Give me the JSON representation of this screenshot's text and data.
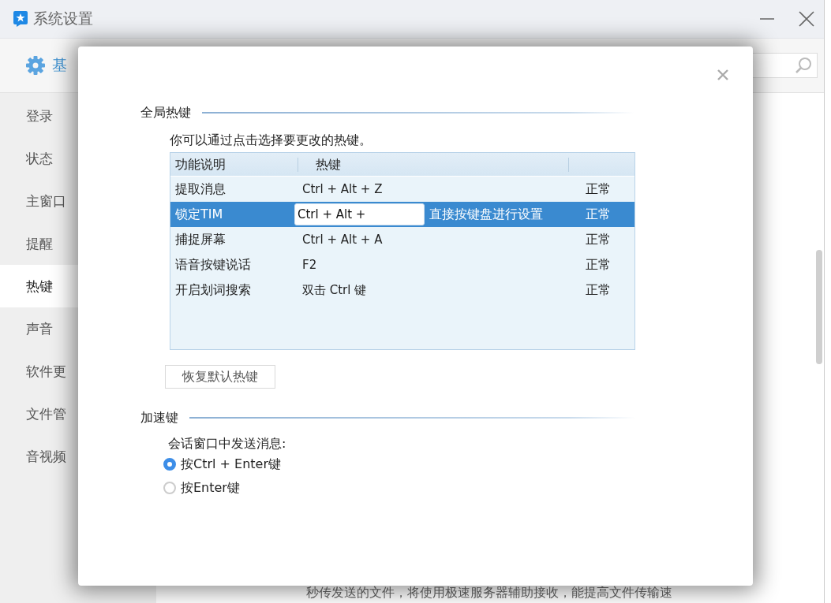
{
  "window": {
    "title": "系统设置"
  },
  "sidebar": {
    "header": "基",
    "items": [
      {
        "label": "登录",
        "selected": false
      },
      {
        "label": "状态",
        "selected": false
      },
      {
        "label": "主窗口",
        "selected": false
      },
      {
        "label": "提醒",
        "selected": false
      },
      {
        "label": "热键",
        "selected": true
      },
      {
        "label": "声音",
        "selected": false
      },
      {
        "label": "软件更",
        "selected": false
      },
      {
        "label": "文件管",
        "selected": false
      },
      {
        "label": "音视频",
        "selected": false
      }
    ]
  },
  "background_text": "秒传发送的文件，将使用极速服务器辅助接收，能提高文件传输速",
  "dialog": {
    "global_hotkeys": {
      "title": "全局热键",
      "description": "你可以通过点击选择要更改的热键。",
      "columns": [
        "功能说明",
        "热键"
      ],
      "rows": [
        {
          "name": "提取消息",
          "hotkey": "Ctrl + Alt + Z",
          "status": "正常",
          "selected": false
        },
        {
          "name": "锁定TIM",
          "hotkey": "Ctrl + Alt +",
          "hint": "直接按键盘进行设置",
          "status": "正常",
          "selected": true
        },
        {
          "name": "捕捉屏幕",
          "hotkey": "Ctrl + Alt + A",
          "status": "正常",
          "selected": false
        },
        {
          "name": "语音按键说话",
          "hotkey": "F2",
          "status": "正常",
          "selected": false
        },
        {
          "name": "开启划词搜索",
          "hotkey": "双击 Ctrl 键",
          "status": "正常",
          "selected": false
        }
      ],
      "restore_button": "恢复默认热键"
    },
    "accelerators": {
      "title": "加速键",
      "label": "会话窗口中发送消息:",
      "options": [
        {
          "label": "按Ctrl + Enter键",
          "selected": true
        },
        {
          "label": "按Enter键",
          "selected": false
        }
      ]
    }
  }
}
